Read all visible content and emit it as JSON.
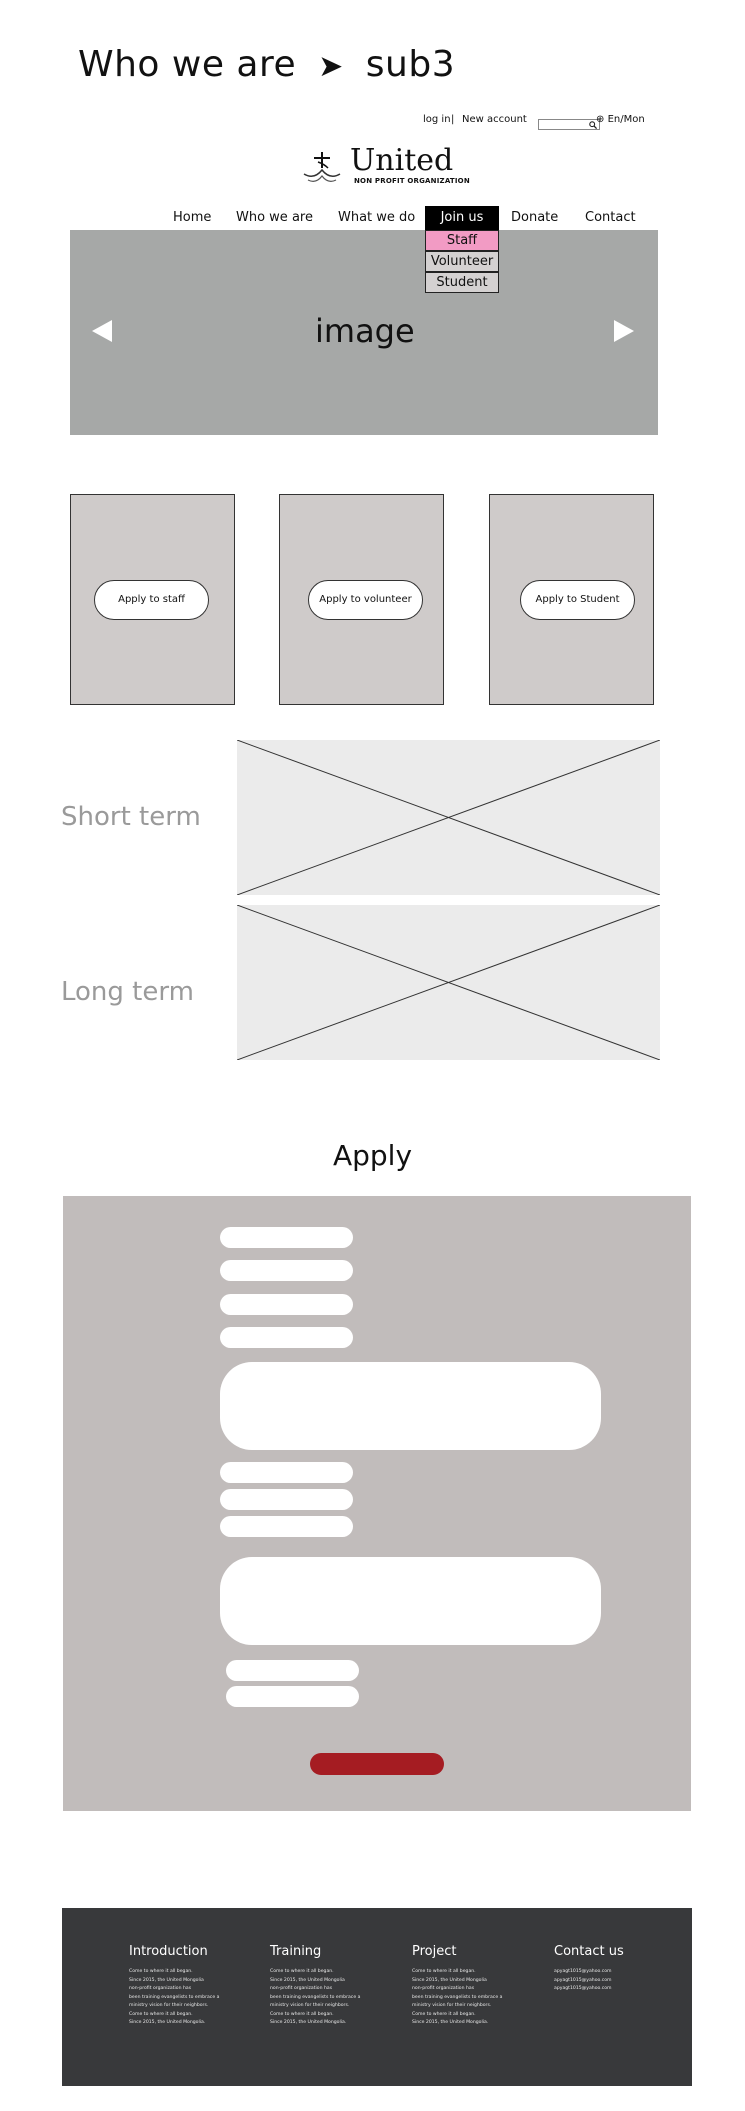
{
  "page_heading": {
    "left": "Who we are",
    "arrow": "➤",
    "right": "sub3"
  },
  "utility": {
    "login": "log in",
    "separator": "|",
    "new_account": "New account",
    "lang_icon": "⊕",
    "lang": "En/Mon",
    "search_icon": "🔍"
  },
  "logo": {
    "name": "United",
    "sub": "NON PROFIT ORGANIZATION"
  },
  "nav": {
    "items": [
      "Home",
      "Who we are",
      "What we do",
      "Join us",
      "Donate",
      "Contact"
    ],
    "submenu": [
      "Staff",
      "Volunteer",
      "Student"
    ]
  },
  "hero": {
    "label": "image"
  },
  "cards": [
    "Apply to staff",
    "Apply to volunteer",
    "Apply to Student"
  ],
  "terms": {
    "short": "Short term",
    "long": "Long term"
  },
  "apply": {
    "title": "Apply"
  },
  "footer": {
    "columns": [
      {
        "title": "Introduction",
        "text": "Come to where it all began.\nSince 2015, the United Mongolia\nnon-profit organization has\nbeen training evangelists to embrace a\nministry vision for their neighbors.\nCome to where it all began.\nSince 2015, the United Mongolia."
      },
      {
        "title": "Training",
        "text": "Come to where it all began.\nSince 2015, the United Mongolia\nnon-profit organization has\nbeen training evangelists to embrace a\nministry vision for their neighbors.\nCome to where it all began.\nSince 2015, the United Mongolia."
      },
      {
        "title": "Project",
        "text": "Come to where it all began.\nSince 2015, the United Mongolia\nnon-profit organization has\nbeen training evangelists to embrace a\nministry vision for their neighbors.\nCome to where it all began.\nSince 2015, the United Mongolia."
      },
      {
        "title": "Contact us",
        "text": "apyagt1015@yahoo.com\napyagt1015@yahoo.com\napyagt1015@yahoo.com"
      }
    ]
  },
  "colors": {
    "nav_active": "#000000",
    "submenu_active": "#f29bc4",
    "submenu_idle": "#d4d1d1",
    "submit": "#a51c22",
    "footer": "#38393b"
  }
}
